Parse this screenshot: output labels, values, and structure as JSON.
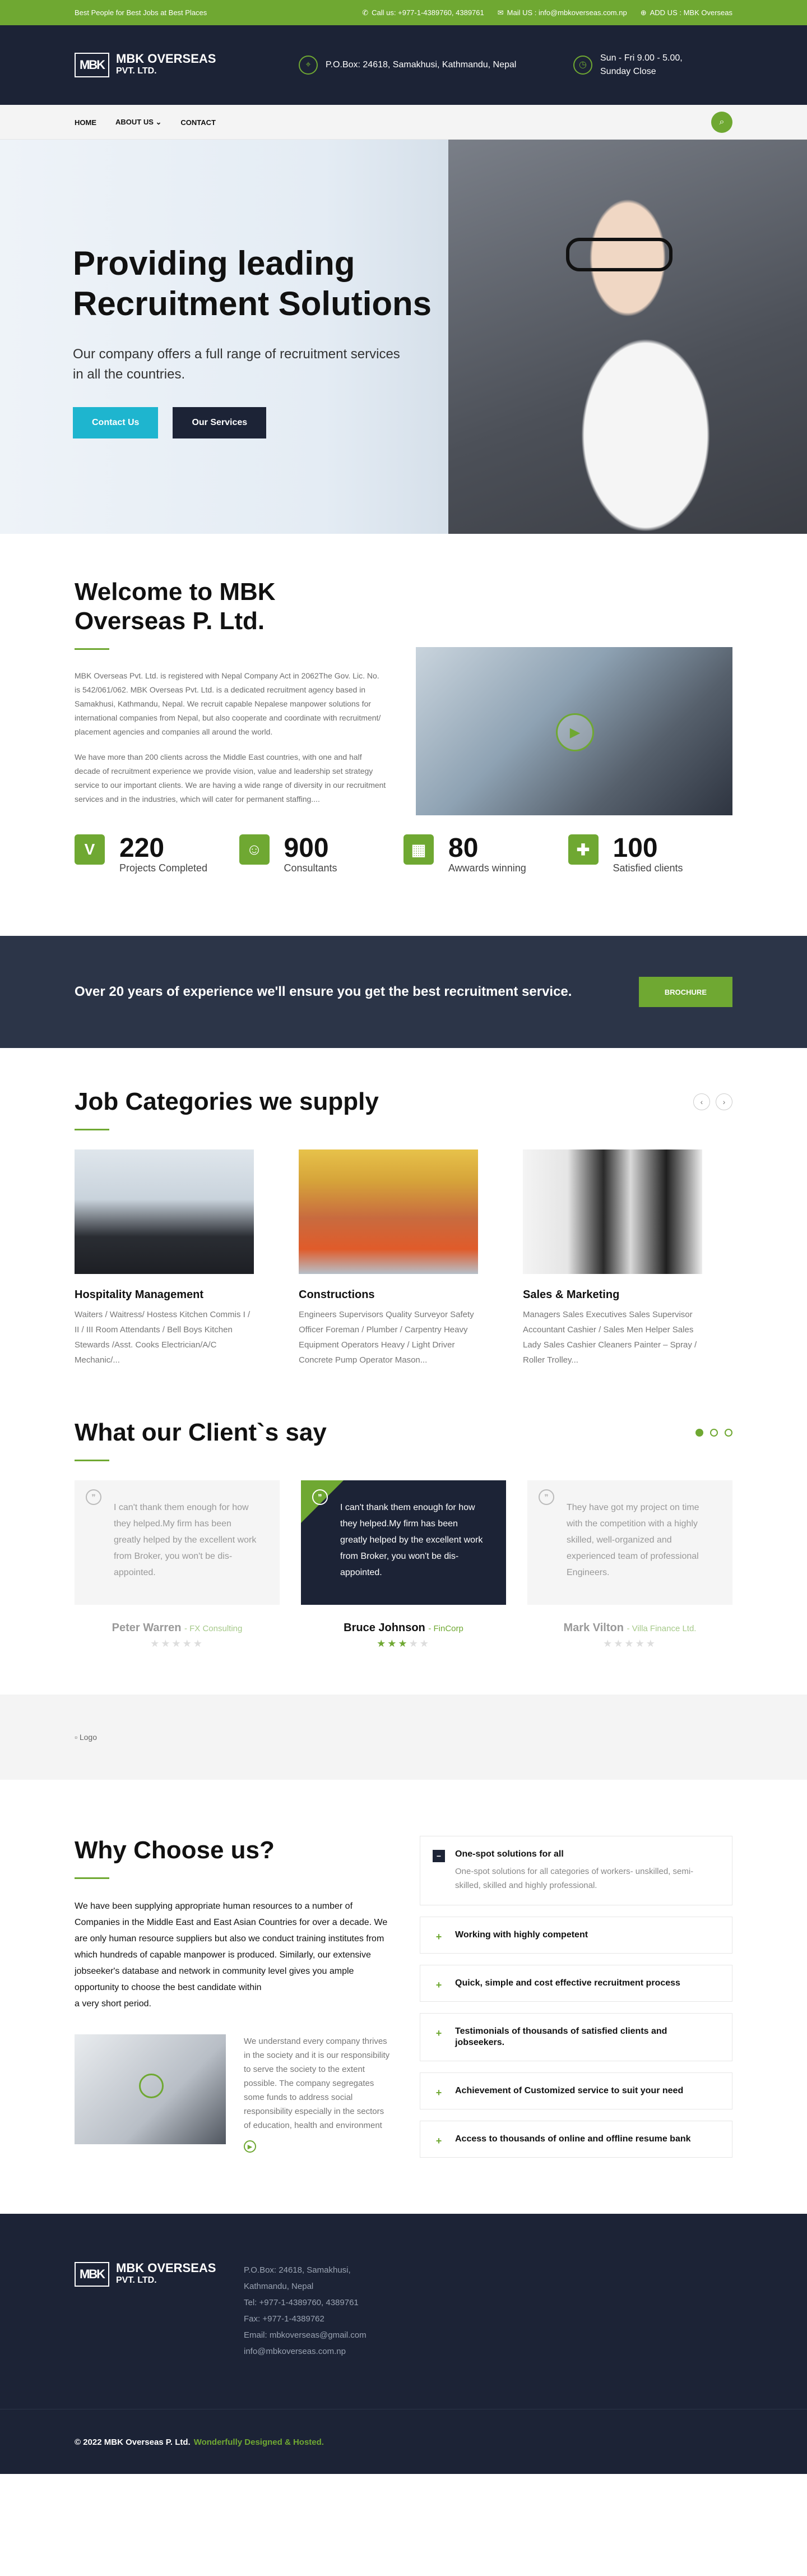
{
  "topbar": {
    "tagline": "Best People for Best Jobs at Best Places",
    "call": "Call us: +977-1-4389760, 4389761",
    "mail": "Mail US : info@mbkoverseas.com.np",
    "add": "ADD US : MBK Overseas"
  },
  "header": {
    "logo_mark": "MBK",
    "logo_name": "MBK OVERSEAS",
    "logo_sub": "PVT. LTD.",
    "address": "P.O.Box: 24618, Samakhusi, Kathmandu, Nepal",
    "hours_line1": "Sun - Fri 9.00 - 5.00,",
    "hours_line2": "Sunday Close"
  },
  "nav": {
    "items": [
      "HOME",
      "ABOUT US ⌄",
      "CONTACT"
    ]
  },
  "hero": {
    "title_line1": "Providing leading",
    "title_line2": "Recruitment Solutions",
    "subtitle": "Our company offers a full range of recruitment services in all the countries.",
    "btn_contact": "Contact Us",
    "btn_services": "Our Services"
  },
  "welcome": {
    "title": "Welcome to MBK Overseas P. Ltd.",
    "para1": "MBK Overseas Pvt. Ltd. is registered with Nepal Company Act in 2062The Gov. Lic. No. is 542/061/062. MBK Overseas Pvt. Ltd. is a dedicated recruitment agency based in Samakhusi, Kathmandu, Nepal. We recruit capable Nepalese manpower solutions for international companies from Nepal, but also cooperate and coordinate with recruitment/ placement agencies and companies all around the world.",
    "para2": "We have more than 200 clients across the Middle East countries, with one and half decade of recruitment experience we provide vision, value and leadership set strategy service to our important clients. We are having a wide range of diversity in our recruitment services and in the industries, which will cater for permanent staffing....",
    "stats": [
      {
        "icon": "V",
        "num": "220",
        "label": "Projects Completed"
      },
      {
        "icon": "☺",
        "num": "900",
        "label": "Consultants"
      },
      {
        "icon": "▦",
        "num": "80",
        "label": "Awwards winning"
      },
      {
        "icon": "✚",
        "num": "100",
        "label": "Satisfied clients"
      }
    ]
  },
  "band": {
    "text": "Over 20 years of experience we'll ensure you get the best recruitment service.",
    "btn": "BROCHURE"
  },
  "categories": {
    "title": "Job Categories we supply",
    "items": [
      {
        "title": "Hospitality Management",
        "text": "Waiters / Waitress/ Hostess Kitchen Commis I / II / III Room Attendants / Bell Boys Kitchen Stewards /Asst. Cooks Electrician/A/C Mechanic/..."
      },
      {
        "title": "Constructions",
        "text": "Engineers Supervisors Quality Surveyor Safety Officer Foreman / Plumber / Carpentry Heavy Equipment Operators Heavy / Light Driver Concrete Pump Operator Mason..."
      },
      {
        "title": "Sales & Marketing",
        "text": "Managers Sales Executives Sales Supervisor Accountant Cashier / Sales Men Helper Sales Lady Sales Cashier Cleaners Painter – Spray / Roller Trolley..."
      }
    ]
  },
  "testimonials": {
    "title": "What our Client`s say",
    "items": [
      {
        "quote": "I can't thank them enough for how they helped.My firm has been greatly helped by the excellent work from Broker, you won't be dis-appointed.",
        "name": "Peter Warren",
        "company": "- FX Consulting"
      },
      {
        "quote": "I can't thank them enough for how they helped.My firm has been greatly helped by the excellent work from Broker, you won't be dis-appointed.",
        "name": "Bruce Johnson",
        "company": "- FinCorp"
      },
      {
        "quote": "They have got my project on time with the competition with a highly skilled, well-organized and experienced team of professional Engineers.",
        "name": "Mark Vilton",
        "company": "- Villa Finance Ltd."
      }
    ]
  },
  "logos": {
    "alt": "Logo"
  },
  "why": {
    "title": "Why Choose us?",
    "lead": "We have been supplying appropriate human resources to a number of Companies in the Middle East and East Asian Countries for over a decade. We are only human resource suppliers but also we conduct training institutes from which hundreds of capable manpower is produced. Similarly, our extensive jobseeker's database and network in community level gives you ample opportunity to choose the best candidate within\na very short period.",
    "sub": "We understand every company thrives in the society and it is our responsibility to serve the society to the extent possible. The company segregates some funds to address social responsibility especially in the sectors of education, health and environment",
    "accordion": [
      {
        "title": "One-spot solutions for all",
        "text": "One-spot solutions for all categories of workers- unskilled, semi-skilled, skilled and highly professional.",
        "open": true
      },
      {
        "title": "Working with highly competent",
        "text": "",
        "open": false
      },
      {
        "title": "Quick, simple and cost effective recruitment process",
        "text": "",
        "open": false
      },
      {
        "title": "Testimonials of thousands of satisfied clients and jobseekers.",
        "text": "",
        "open": false
      },
      {
        "title": "Achievement of Customized service to suit your need",
        "text": "",
        "open": false
      },
      {
        "title": "Access to thousands of online and offline resume bank",
        "text": "",
        "open": false
      }
    ]
  },
  "footer": {
    "address": [
      "P.O.Box: 24618, Samakhusi,",
      "Kathmandu, Nepal",
      "Tel: +977-1-4389760, 4389761",
      "Fax: +977-1-4389762",
      "Email: mbkoverseas@gmail.com",
      "info@mbkoverseas.com.np"
    ],
    "copyright": "© 2022 MBK Overseas P. Ltd.",
    "credit": "Wonderfully Designed & Hosted."
  }
}
